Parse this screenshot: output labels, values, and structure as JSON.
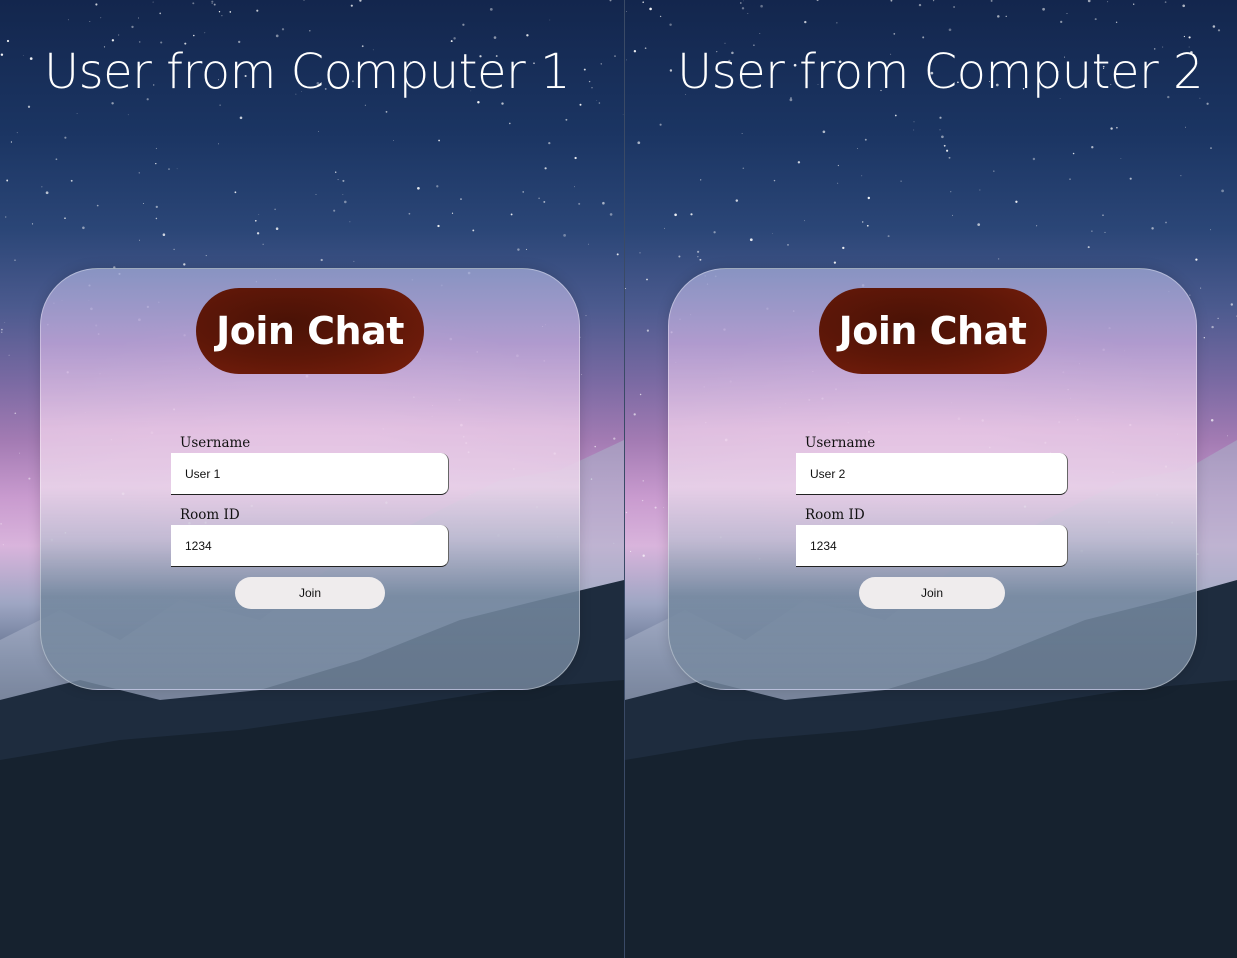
{
  "panes": [
    {
      "heading": "User from Computer 1",
      "card": {
        "title": "Join Chat",
        "username_label": "Username",
        "username_value": "User 1",
        "room_label": "Room ID",
        "room_value": "1234",
        "join_label": "Join"
      }
    },
    {
      "heading": "User from Computer 2",
      "card": {
        "title": "Join Chat",
        "username_label": "Username",
        "username_value": "User 2",
        "room_label": "Room ID",
        "room_value": "1234",
        "join_label": "Join"
      }
    }
  ],
  "colors": {
    "title_pill": "#5e1708",
    "join_button": "#efeced",
    "heading_text": "#ffffff"
  }
}
